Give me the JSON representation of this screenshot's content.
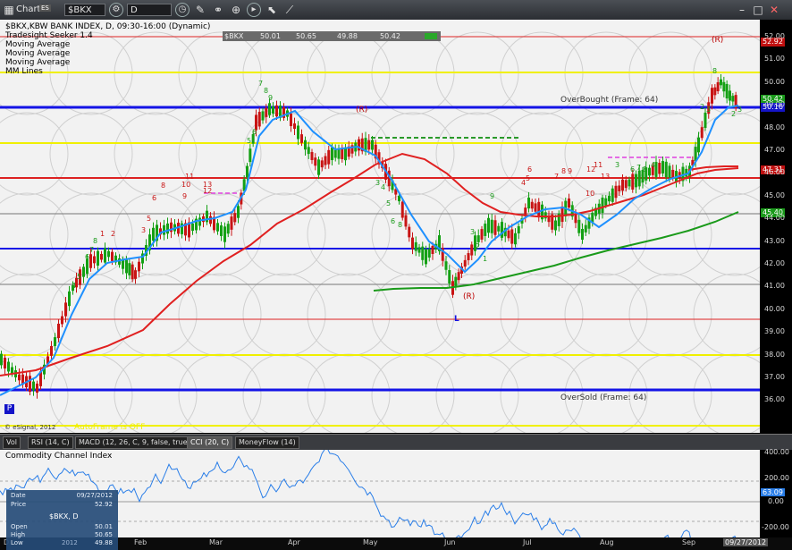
{
  "titlebar": {
    "title": "Chart",
    "badge": "ES",
    "symbol": "$BKX",
    "interval": "D"
  },
  "quote_header": {
    "symbol": "$BKX",
    "last": "50.01",
    "high": "50.65",
    "low": "49.88",
    "close": "50.42"
  },
  "legend": {
    "line1": "$BKX,KBW BANK INDEX, D, 09:30-16:00 (Dynamic)",
    "line2": "Tradesight Seeker 1.4",
    "line3": "Moving Average",
    "line4": "Moving Average",
    "line5": "Moving Average",
    "line6": "MM Lines"
  },
  "annotations": {
    "overbought": "OverBought (Frame: 64)",
    "oversold": "OverSold (Frame: 64)",
    "autoframe": "AutoFrame is OFF",
    "copyright": "© eSignal, 2012",
    "r_top": "(R)",
    "r_mid": "(R)",
    "r_low": "(R)",
    "l_low": "L",
    "p_marker": "P"
  },
  "price_axis": [
    "52.00",
    "51.00",
    "50.00",
    "49.00",
    "48.00",
    "47.00",
    "46.00",
    "45.00",
    "44.00",
    "43.00",
    "42.00",
    "41.00",
    "40.00",
    "39.00",
    "38.00",
    "37.00",
    "36.00"
  ],
  "price_tags": {
    "top": "52.92",
    "close": "50.42",
    "close2": "50.16",
    "ma1": "47.31",
    "ma2": "45.40"
  },
  "tabs": [
    "Vol",
    "RSI (14, C)",
    "MACD (12, 26, C, 9, false, true)",
    "CCI (20, C)",
    "MoneyFlow (14)"
  ],
  "cci": {
    "title": "Commodity Channel Index",
    "axis": [
      "400.00",
      "200.00",
      "0.00",
      "-200.00"
    ],
    "value": "63.09"
  },
  "x_axis": [
    "Feb",
    "Mar",
    "Apr",
    "May",
    "Jun",
    "Jul",
    "Aug",
    "Sep"
  ],
  "x_axis_end": "09/27/2012",
  "x_axis_start": "D",
  "databox": {
    "date_label": "Date",
    "date": "09/27/2012",
    "price_label": "Price",
    "price": "52.92",
    "symbol": "$BKX, D",
    "open_label": "Open",
    "open": "50.01",
    "high_label": "High",
    "high": "50.65",
    "low_label": "Low",
    "low": "49.88",
    "year": "2012"
  },
  "colors": {
    "up": "#14a014",
    "down": "#c81414",
    "ma_blue": "#1e90ff",
    "ma_red": "#e02020",
    "ma_green": "#1a9a1a",
    "level_blue": "#1414e6",
    "level_red": "#d22",
    "level_yellow": "#f0f000"
  }
}
